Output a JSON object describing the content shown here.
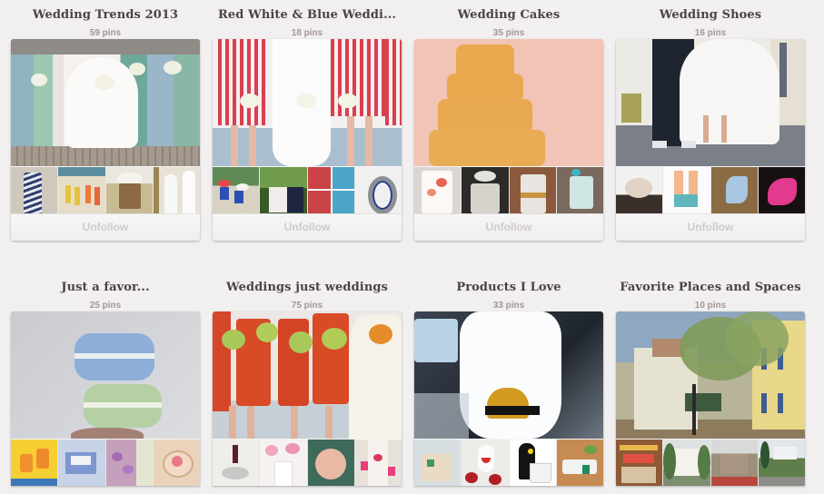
{
  "boards": [
    {
      "title": "Wedding Trends 2013",
      "pins": "59 pins",
      "cover": "bridesmaids-pastel-dresses-photo",
      "thumbs": [
        "blue-chevron-dress-photo",
        "colorful-bridesmaids-beach-photo",
        "wooden-barrel-flowers-photo",
        "wedding-dress-front-back-photo"
      ],
      "button": "Unfollow"
    },
    {
      "title": "Red White & Blue Weddi...",
      "pins": "18 pins",
      "cover": "red-striped-bridesmaids-photo",
      "thumbs": [
        "flag-centerpieces-photo",
        "navy-invitation-photo",
        "red-blue-collage-photo",
        "striped-wedding-ring-photo"
      ],
      "button": "Unfollow"
    },
    {
      "title": "Wedding Cakes",
      "pins": "35 pins",
      "cover": "orange-tiered-cake-photo",
      "thumbs": [
        "floral-painted-cake-photo",
        "birch-bark-cake-photo",
        "gold-white-cake-photo",
        "mint-lace-cake-photo"
      ],
      "button": "Unfollow"
    },
    {
      "title": "Wedding Shoes",
      "pins": "16 pins",
      "cover": "bride-groom-sneakers-photo",
      "thumbs": [
        "bridal-shoe-soles-photo",
        "peach-teal-heels-photo",
        "blue-heels-photo",
        "pink-glitter-heel-photo"
      ],
      "button": "Unfollow"
    },
    {
      "title": "Just a favor...",
      "pins": "25 pins",
      "cover": "pastel-macarons-photo",
      "thumbs": [
        "orange-favor-bags-photo",
        "blue-stamp-favors-photo",
        "lavender-favors-collage-photo",
        "peach-cookie-favor-photo"
      ]
    },
    {
      "title": "Weddings just weddings",
      "pins": "75 pins",
      "cover": "orange-bridesmaids-bouquets-photo",
      "thumbs": [
        "plum-table-setting-photo",
        "pink-flower-place-setting-photo",
        "green-plate-setting-photo",
        "pink-long-table-photo"
      ]
    },
    {
      "title": "Products I Love",
      "pins": "33 pins",
      "cover": "headlamp-lantern-photo",
      "thumbs": [
        "desk-organizer-photo",
        "apple-face-gadget-photo",
        "penguin-mug-photo",
        "planter-sink-photo"
      ]
    },
    {
      "title": "Favorite Places and Spaces",
      "pins": "10 pins",
      "cover": "painted-town-street-photo",
      "thumbs": [
        "bakery-shop-photo",
        "white-house-trees-photo",
        "brick-house-photo",
        "coastal-house-photo"
      ]
    }
  ],
  "colors": {
    "background": "#f1efef",
    "title": "#4b4345",
    "pins": "#a29597",
    "button_text": "#cfcbcb"
  }
}
